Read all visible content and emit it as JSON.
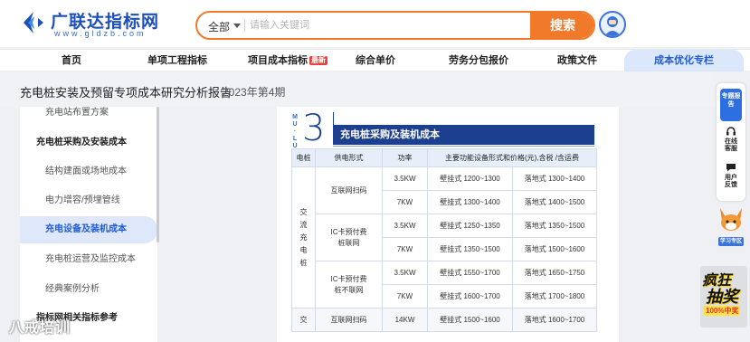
{
  "brand": {
    "name": "广联达指标网",
    "url": "www.gldzb.com",
    "color": "#1c4fb8"
  },
  "search": {
    "scope": "全部",
    "placeholder": "请输入关键词",
    "button_label": "搜索",
    "accent": "#f07a2a"
  },
  "nav": {
    "items": [
      {
        "label": "首页"
      },
      {
        "label": "单项工程指标"
      },
      {
        "label": "项目成本指标",
        "badge": "最新"
      },
      {
        "label": "综合单价"
      },
      {
        "label": "劳务分包报价"
      },
      {
        "label": "政策文件"
      }
    ],
    "active_label": "成本优化专栏"
  },
  "report": {
    "title": "充电桩安装及预留专项成本研究分析报告",
    "issue": "2023年第4期"
  },
  "sidebar": {
    "items": [
      {
        "label": "充电站布置方案",
        "kind": "sub"
      },
      {
        "label": "充电桩采购及安装成本",
        "kind": "group"
      },
      {
        "label": "结构建面或场地成本",
        "kind": "sub"
      },
      {
        "label": "电力增容/预埋管线",
        "kind": "sub"
      },
      {
        "label": "充电设备及装机成本",
        "kind": "active"
      },
      {
        "label": "充电桩运营及监控成本",
        "kind": "sub"
      },
      {
        "label": "经典案例分析",
        "kind": "sub"
      },
      {
        "label": "指标网相关指标参考",
        "kind": "group"
      }
    ]
  },
  "section": {
    "mulu": [
      "M",
      "U",
      "·",
      "L",
      "U"
    ],
    "number": "3",
    "title": "充电桩采购及装机成本",
    "color": "#1d3f8f"
  },
  "table": {
    "headers": [
      "电桩",
      "供电形式",
      "功率",
      "主要功能设备形式和价格(元),含税 /含运费"
    ],
    "group1_label": [
      "交",
      "流",
      "充",
      "电",
      "桩"
    ],
    "group2_label": [
      "交"
    ],
    "rows": [
      {
        "supply": "互联网扫码",
        "power": "3.5KW",
        "wall": "壁挂式 1200~1300",
        "floor": "落地式 1300~1400"
      },
      {
        "supply": "",
        "power": "7KW",
        "wall": "壁挂式 1300~1400",
        "floor": "落地式 1400~1500"
      },
      {
        "supply": "IC卡预付费\n桩联网",
        "power": "3.5KW",
        "wall": "壁挂式 1250~1350",
        "floor": "落地式 1350~1500"
      },
      {
        "supply": "",
        "power": "7KW",
        "wall": "壁挂式 1350~1500",
        "floor": "落地式 1500~1600"
      },
      {
        "supply": "IC卡预付费\n桩不联网",
        "power": "3.5KW",
        "wall": "壁挂式 1550~1700",
        "floor": "落地式 1650~1750"
      },
      {
        "supply": "",
        "power": "7KW",
        "wall": "壁挂式 1600~1700",
        "floor": "落地式 1700~1800"
      },
      {
        "supply": "互联网扫码",
        "power": "14KW",
        "wall": "壁挂式 1500~1600",
        "floor": "落地式 1600~1700"
      }
    ]
  },
  "floatbar": {
    "topic_label": "专题报告",
    "service_label": "在线客服",
    "feedback_label": "用户反馈",
    "mascot_label": "学习专区",
    "promo_label_1": "疯狂",
    "promo_label_2": "抽奖",
    "promo_label_3": "100%中奖"
  },
  "watermark": "八戒培训"
}
